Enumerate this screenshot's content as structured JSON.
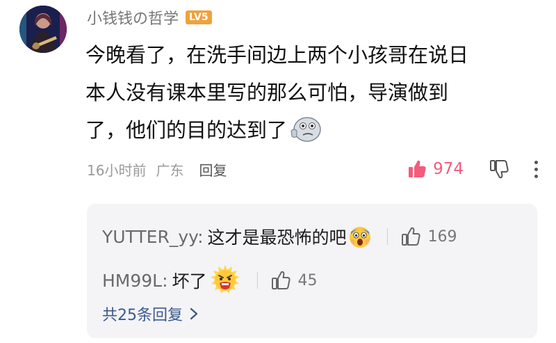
{
  "comment": {
    "username": "小钱钱の哲学",
    "level_badge": "LV5",
    "body_lines": [
      "今晚看了，在洗手间边上两个小孩哥在说日",
      "本人没有课本里写的那么可怕，导演做到",
      "了，他们的目的达到了"
    ],
    "body_emoji": "thinking-face-emoji",
    "time": "16小时前",
    "location": "广东",
    "reply_label": "回复",
    "like_count": "974",
    "like_active_color": "#f45b7c"
  },
  "replies": [
    {
      "author": "YUTTER_yy:",
      "text": "这才是最恐怖的吧",
      "emoji": "screaming-face-emoji",
      "like_count": "169"
    },
    {
      "author": "HM99L:",
      "text": "坏了",
      "emoji": "shocked-face-emoji",
      "like_count": "45"
    }
  ],
  "view_all_replies": "共25条回复"
}
